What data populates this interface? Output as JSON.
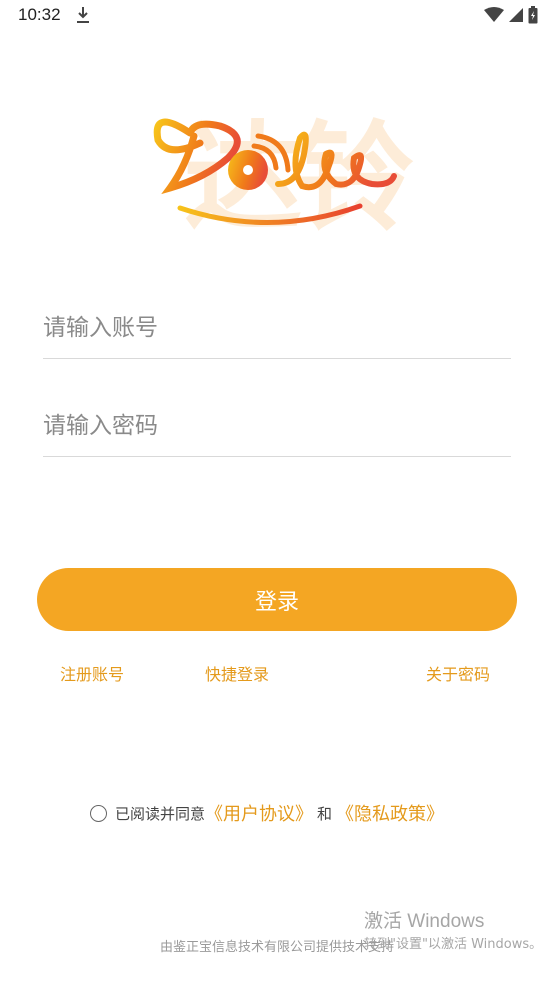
{
  "status_bar": {
    "time": "10:32",
    "icons": [
      "download-icon",
      "wifi-icon",
      "signal-icon",
      "battery-icon"
    ]
  },
  "logo": {
    "background_text": "达铃",
    "script_text": "Doliee",
    "gradient_colors": [
      "#f7c21a",
      "#f07a1a",
      "#e84d37"
    ]
  },
  "form": {
    "account_placeholder": "请输入账号",
    "password_placeholder": "请输入密码",
    "login_label": "登录"
  },
  "links": {
    "register": "注册账号",
    "quick_login": "快捷登录",
    "about_password": "关于密码"
  },
  "agreement": {
    "prefix": "已阅读并同意",
    "user_agreement": "《用户协议》",
    "and": "和",
    "privacy_policy": "《隐私政策》"
  },
  "footer": {
    "provider": "由鉴正宝信息技术有限公司提供技术支持"
  },
  "watermark": {
    "title": "激活 Windows",
    "subtitle": "转到\"设置\"以激活 Windows。"
  },
  "colors": {
    "accent": "#f4a623",
    "link": "#e49a1c"
  }
}
